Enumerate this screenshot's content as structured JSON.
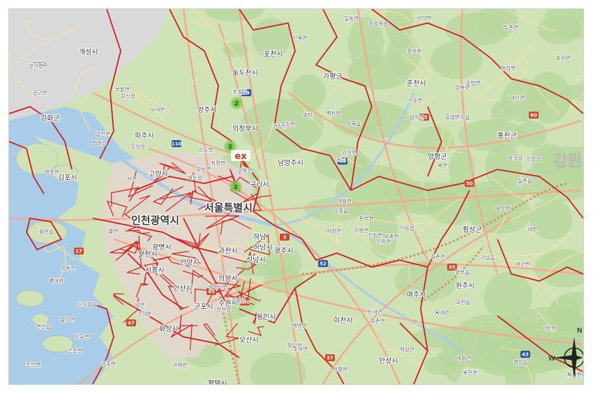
{
  "map": {
    "colors": {
      "land": "#cfe3b6",
      "forest": "#b7d59c",
      "urban": "#e3d6cf",
      "water": "#a9cde8",
      "dmz": "#d9d9d9",
      "admin_border": "#d11f1f",
      "road_major": "#f3a98b",
      "road_minor": "#fbe29a",
      "cluster": "#7cc84a"
    },
    "city_labels": [
      "개성시",
      "포천시",
      "동두천시",
      "양주시",
      "의정부시",
      "남양주시",
      "가평군",
      "춘천시",
      "홍천군",
      "양평군",
      "구리시",
      "하남시",
      "광주시",
      "여주시",
      "이천시",
      "원주시",
      "인천광역시",
      "부천시",
      "시흥시",
      "안산시",
      "화성시",
      "오산시",
      "수원시",
      "용인시",
      "평택시",
      "안성시",
      "횡성군",
      "파주시",
      "고양시",
      "김포시",
      "강화군",
      "서울특별시",
      "성남시",
      "안양시",
      "광명시",
      "과천시",
      "의왕시",
      "군포시",
      "하남",
      "강원도"
    ],
    "minor_labels": [
      "가평읍",
      "청평면",
      "설악면",
      "서종면",
      "양서면",
      "옥천면",
      "지평면",
      "양동면",
      "강상면",
      "개군면",
      "대신면",
      "북내면",
      "점동면",
      "가남읍",
      "부발읍",
      "마장면",
      "모가면",
      "설성면",
      "율면",
      "장호원읍",
      "백사면",
      "신둔면",
      "대월면",
      "호법면",
      "실촌읍",
      "도척면",
      "퇴촌면",
      "남종면",
      "곤지암읍",
      "초월읍",
      "오포읍",
      "중부면",
      "포곡읍",
      "모현읍",
      "이동읍",
      "원삼면",
      "백암면",
      "양지면",
      "남사읍",
      "송탄",
      "진위면",
      "청북읍",
      "팽성읍",
      "고덕면",
      "서탄면",
      "문산읍",
      "법원읍",
      "적성면",
      "연천읍",
      "신북면",
      "영중면",
      "일동면",
      "이동면",
      "화도읍",
      "수동면",
      "조안면",
      "와부읍",
      "진접읍",
      "오남읍",
      "별내면",
      "퇴계원읍",
      "서면",
      "동면",
      "남면",
      "북면",
      "화천읍",
      "사내면",
      "내면",
      "두촌면",
      "화촌면",
      "서석면",
      "영귀미면",
      "청일면",
      "갑천면",
      "공근면",
      "둔내면",
      "안흥면",
      "강림면",
      "우천면",
      "문막읍",
      "지정면",
      "부론면",
      "귀래면",
      "호저면",
      "판부면",
      "신림면",
      "소초면",
      "흥업면",
      "대화면"
    ],
    "cluster_counts": [
      "2",
      "2",
      "2"
    ],
    "road_shields": [
      "29",
      "55",
      "60",
      "65",
      "50",
      "45",
      "52",
      "35",
      "100",
      "110",
      "17",
      "37",
      "43",
      "47",
      "3"
    ],
    "compass": {
      "west": "W",
      "north": "N"
    },
    "logo_text": "ex"
  }
}
